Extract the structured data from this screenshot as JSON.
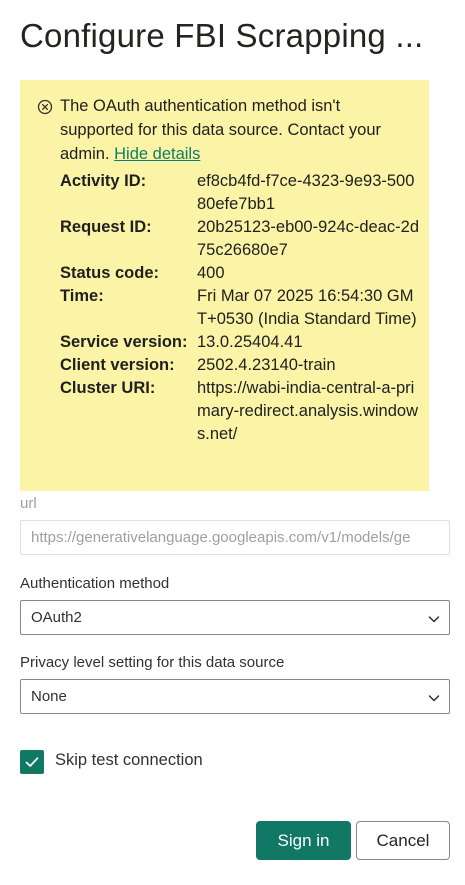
{
  "dialog": {
    "title": "Configure FBI Scrapping ..."
  },
  "error": {
    "icon": "dismiss-circle-icon",
    "message": "The OAuth authentication method isn't supported for this data source. Contact your admin.",
    "link_label": "Hide details",
    "details": [
      {
        "label": "Activity ID:",
        "value": "ef8cb4fd-f7ce-4323-9e93-50080efe7bb1"
      },
      {
        "label": "Request ID:",
        "value": "20b25123-eb00-924c-deac-2d75c26680e7"
      },
      {
        "label": "Status code:",
        "value": "400"
      },
      {
        "label": "Time:",
        "value": "Fri Mar 07 2025 16:54:30 GMT+0530 (India Standard Time)"
      },
      {
        "label": "Service version:",
        "value": "13.0.25404.41"
      },
      {
        "label": "Client version:",
        "value": "2502.4.23140-train"
      },
      {
        "label": "Cluster URI:",
        "value": "https://wabi-india-central-a-primary-redirect.analysis.windows.net/"
      }
    ]
  },
  "url_field": {
    "label": "url",
    "value": "https://generativelanguage.googleapis.com/v1/models/ge"
  },
  "auth_field": {
    "label": "Authentication method",
    "value": "OAuth2"
  },
  "privacy_field": {
    "label": "Privacy level setting for this data source",
    "value": "None"
  },
  "skip_test": {
    "label": "Skip test connection",
    "checked": true
  },
  "buttons": {
    "sign_in": "Sign in",
    "cancel": "Cancel"
  },
  "colors": {
    "accent": "#117865",
    "error_background": "#fbf3a6",
    "link": "#107c6b"
  }
}
